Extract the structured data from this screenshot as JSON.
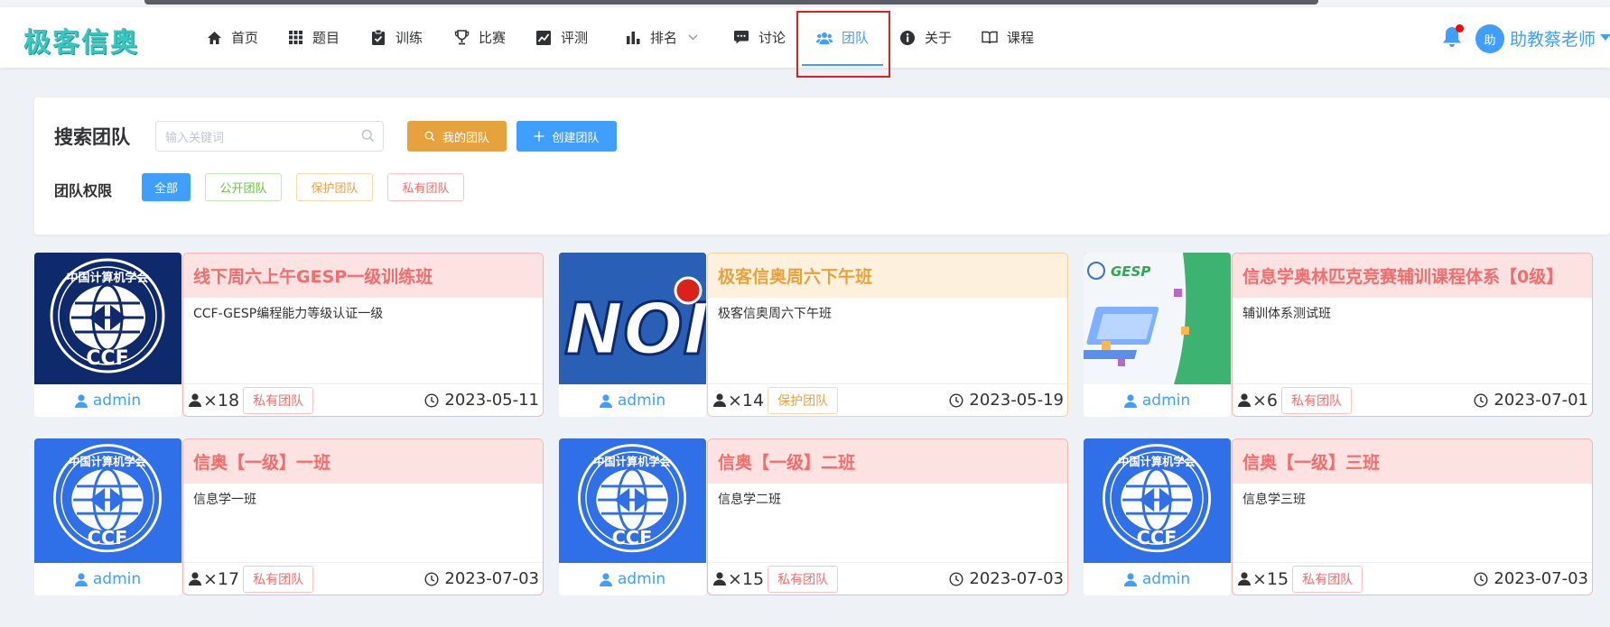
{
  "header": {
    "logo": "极客信奥",
    "nav": [
      {
        "label": "首页",
        "icon": "home-icon"
      },
      {
        "label": "题目",
        "icon": "grid-icon"
      },
      {
        "label": "训练",
        "icon": "clipboard-icon"
      },
      {
        "label": "比赛",
        "icon": "trophy-icon"
      },
      {
        "label": "评测",
        "icon": "chart-line-icon"
      },
      {
        "label": "排名",
        "icon": "bar-chart-icon"
      },
      {
        "label": "讨论",
        "icon": "chat-icon"
      },
      {
        "label": "团队",
        "icon": "users-icon",
        "active": true
      },
      {
        "label": "关于",
        "icon": "info-icon"
      },
      {
        "label": "课程",
        "icon": "book-icon"
      }
    ],
    "user": {
      "avatar": "助",
      "name": "助教蔡老师"
    }
  },
  "search": {
    "title": "搜索团队",
    "placeholder": "输入关键词",
    "my_team_label": "我的团队",
    "create_team_label": "创建团队",
    "perm_label": "团队权限",
    "filters": [
      "全部",
      "公开团队",
      "保护团队",
      "私有团队"
    ]
  },
  "teams": [
    {
      "name": "线下周六上午GESP一级训练班",
      "desc": "CCF-GESP编程能力等级认证一级",
      "owner": "admin",
      "count": "×18",
      "type": "私有团队",
      "date": "2023-05-11",
      "image": "ccf-logo"
    },
    {
      "name": "极客信奥周六下午班",
      "desc": "极客信奥周六下午班",
      "owner": "admin",
      "count": "×14",
      "type": "保护团队",
      "date": "2023-05-19",
      "image": "noi-logo"
    },
    {
      "name": "信息学奥林匹克竞赛辅训课程体系【0级】",
      "desc": "辅训体系测试班",
      "owner": "admin",
      "count": "×6",
      "type": "私有团队",
      "date": "2023-07-01",
      "image": "gesp-banner"
    },
    {
      "name": "信奥【一级】一班",
      "desc": "信息学一班",
      "owner": "admin",
      "count": "×17",
      "type": "私有团队",
      "date": "2023-07-03",
      "image": "ccf-logo"
    },
    {
      "name": "信奥【一级】二班",
      "desc": "信息学二班",
      "owner": "admin",
      "count": "×15",
      "type": "私有团队",
      "date": "2023-07-03",
      "image": "ccf-logo"
    },
    {
      "name": "信奥【一级】三班",
      "desc": "信息学三班",
      "owner": "admin",
      "count": "×15",
      "type": "私有团队",
      "date": "2023-07-03",
      "image": "ccf-logo"
    }
  ],
  "images": {
    "ccf_ring_text": "中国计算机学会",
    "ccf_text": "CCF",
    "noi_text": "NOI",
    "gesp_text": "GESP"
  },
  "colors": {
    "primary": "#409eff",
    "warning": "#e6a23c",
    "danger": "#f56c6c",
    "success": "#67c23a",
    "logo": "#37c6c0"
  }
}
